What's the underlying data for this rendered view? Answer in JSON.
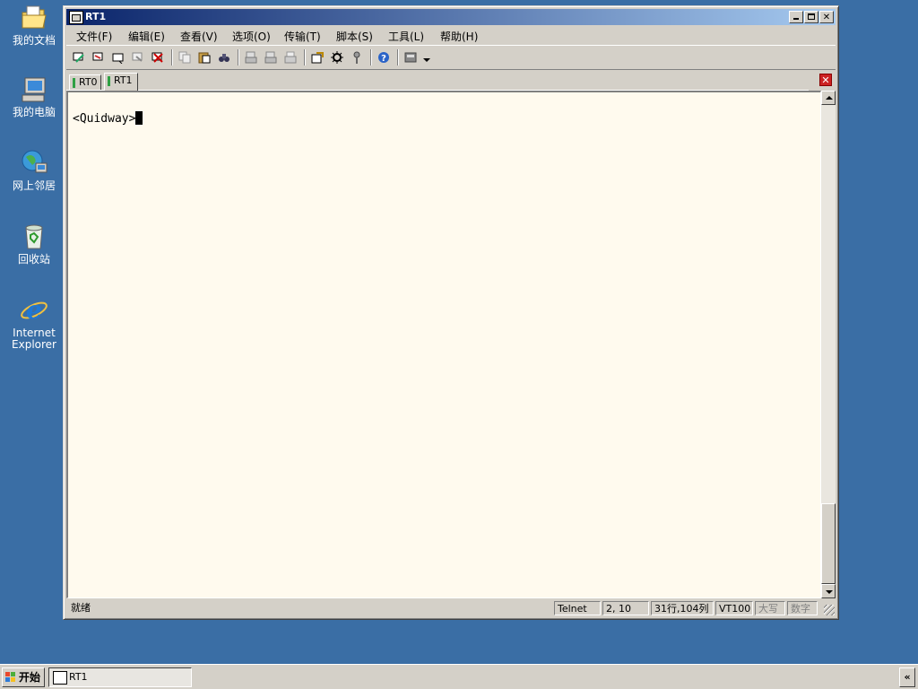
{
  "desktop": {
    "icons": [
      {
        "label": "我的文档",
        "icon": "my-documents-icon"
      },
      {
        "label": "我的电脑",
        "icon": "my-computer-icon"
      },
      {
        "label": "网上邻居",
        "icon": "network-places-icon"
      },
      {
        "label": "回收站",
        "icon": "recycle-bin-icon"
      },
      {
        "label": "Internet\nExplorer",
        "icon": "internet-explorer-icon"
      }
    ]
  },
  "window": {
    "title": "RT1",
    "menu": [
      "文件(F)",
      "编辑(E)",
      "查看(V)",
      "选项(O)",
      "传输(T)",
      "脚本(S)",
      "工具(L)",
      "帮助(H)"
    ],
    "tabs": [
      {
        "label": "RT0",
        "active": false
      },
      {
        "label": "RT1",
        "active": true
      }
    ],
    "terminal": {
      "prompt": "<Quidway>"
    },
    "status": {
      "ready": "就绪",
      "protocol": "Telnet",
      "position": "2,  10",
      "size": "31行,104列",
      "emulation": "VT100",
      "caps": "大写",
      "num": "数字"
    }
  },
  "taskbar": {
    "start_label": "开始",
    "task_label": "RT1",
    "tray_toggle": "«"
  },
  "colors": {
    "desktop": "#3a6ea5",
    "terminal_bg": "#fffaee",
    "title_gradient_start": "#0a246a",
    "tab_indicator": "#2ea043"
  }
}
